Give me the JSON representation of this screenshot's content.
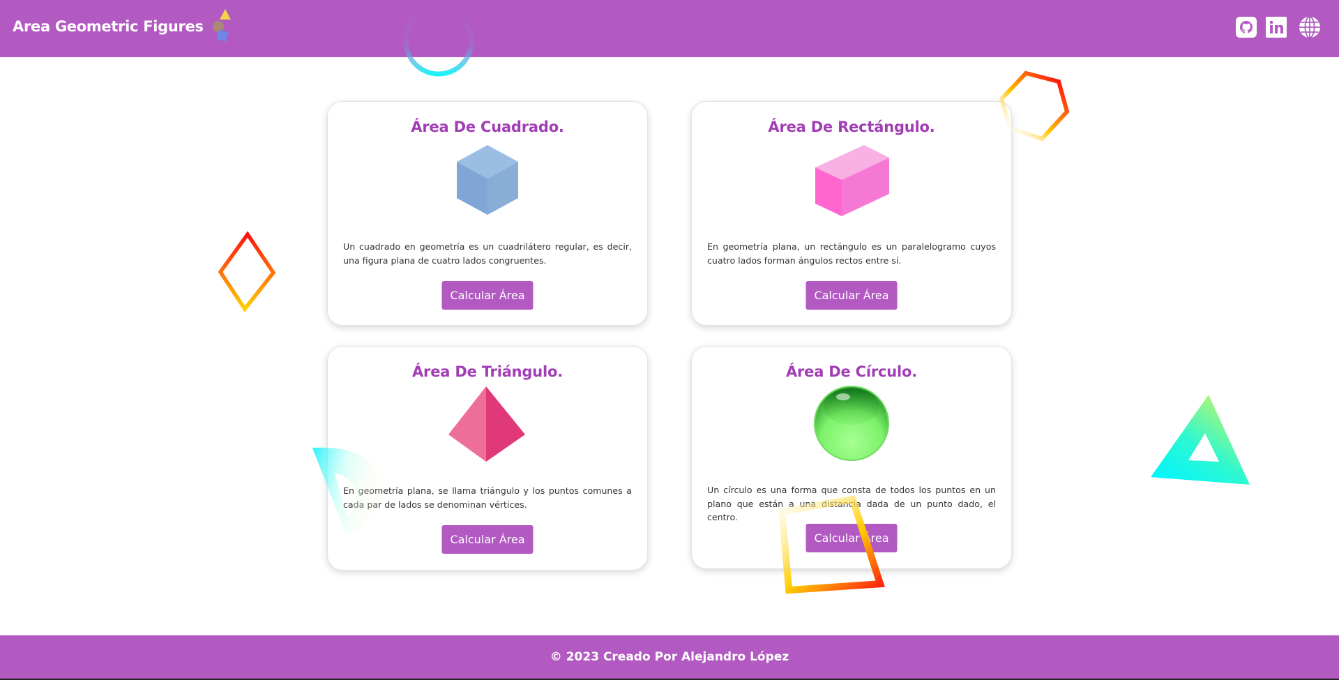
{
  "header": {
    "title": "Area Geometric Figures",
    "links": [
      {
        "icon": "github-icon"
      },
      {
        "icon": "linkedin-icon"
      },
      {
        "icon": "globe-icon"
      }
    ]
  },
  "cards": {
    "square": {
      "title": "Área De Cuadrado.",
      "description": "Un cuadrado en geometría es un cuadrilátero regular, es decir, una figura plana de cuatro lados congruentes.",
      "button": "Calcular Área",
      "figure": "blue-cube-icon"
    },
    "rectangle": {
      "title": "Área De Rectángulo.",
      "description": "En geometría plana, un rectángulo es un paralelogramo cuyos cuatro lados forman ángulos rectos entre sí.",
      "button": "Calcular Área",
      "figure": "pink-box-icon"
    },
    "triangle": {
      "title": "Área De Triángulo.",
      "description": "En geometría plana, se llama triángulo y los puntos comunes a cada par de lados se denominan vértices.",
      "button": "Calcular Área",
      "figure": "pink-pyramid-icon"
    },
    "circle": {
      "title": "Área De Círculo.",
      "description": "Un círculo es una forma que consta de todos los puntos en un plano que están a una distancia dada de un punto dado, el centro.",
      "button": "Calcular Área",
      "figure": "green-sphere-icon"
    }
  },
  "footer": {
    "text": "© 2023 Creado Por Alejandro López"
  },
  "colors": {
    "brand": "#b25ac2",
    "title": "#a13db5"
  }
}
